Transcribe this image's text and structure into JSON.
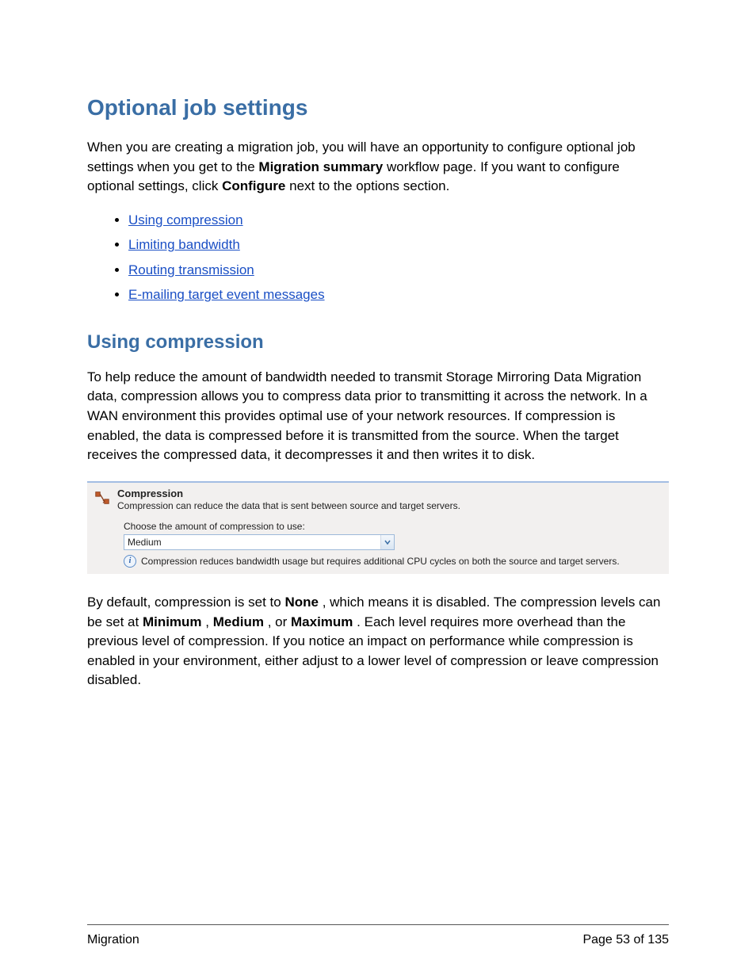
{
  "title": "Optional job settings",
  "intro": {
    "t1": "When you are creating a migration job, you will have an opportunity to configure optional job settings when you get to the ",
    "b1": "Migration summary",
    "t2": " workflow page. If you want to configure optional settings, click ",
    "b2": "Configure",
    "t3": " next to the options section."
  },
  "links": [
    "Using compression",
    "Limiting bandwidth",
    "Routing transmission",
    "E-mailing target event messages"
  ],
  "section_heading": "Using compression",
  "section_body": "To help reduce the amount of bandwidth needed to transmit Storage Mirroring Data Migration data, compression allows you to compress data prior to transmitting it across the network. In a WAN environment this provides optimal use of your network resources. If compression is enabled, the data is compressed before it is transmitted from the source. When the target receives the compressed data, it decompresses it and then writes it to disk.",
  "panel": {
    "title": "Compression",
    "desc": "Compression can reduce the data that is sent between source and target servers.",
    "choose_label": "Choose the amount of compression to use:",
    "selected": "Medium",
    "info": "Compression reduces bandwidth usage but requires additional CPU cycles on both the source and target servers."
  },
  "closing": {
    "t1": "By default, compression is set to ",
    "b1": "None",
    "t2": ", which means it is disabled. The compression levels can be set at ",
    "b2": "Minimum",
    "c2": ", ",
    "b3": "Medium",
    "c3": ", or ",
    "b4": "Maximum",
    "t3": ". Each level requires more overhead than the previous level of compression. If you notice an impact on performance while compression is enabled in your environment, either adjust to a lower level of compression or leave compression disabled."
  },
  "footer": {
    "left": "Migration",
    "right": "Page 53 of 135"
  }
}
